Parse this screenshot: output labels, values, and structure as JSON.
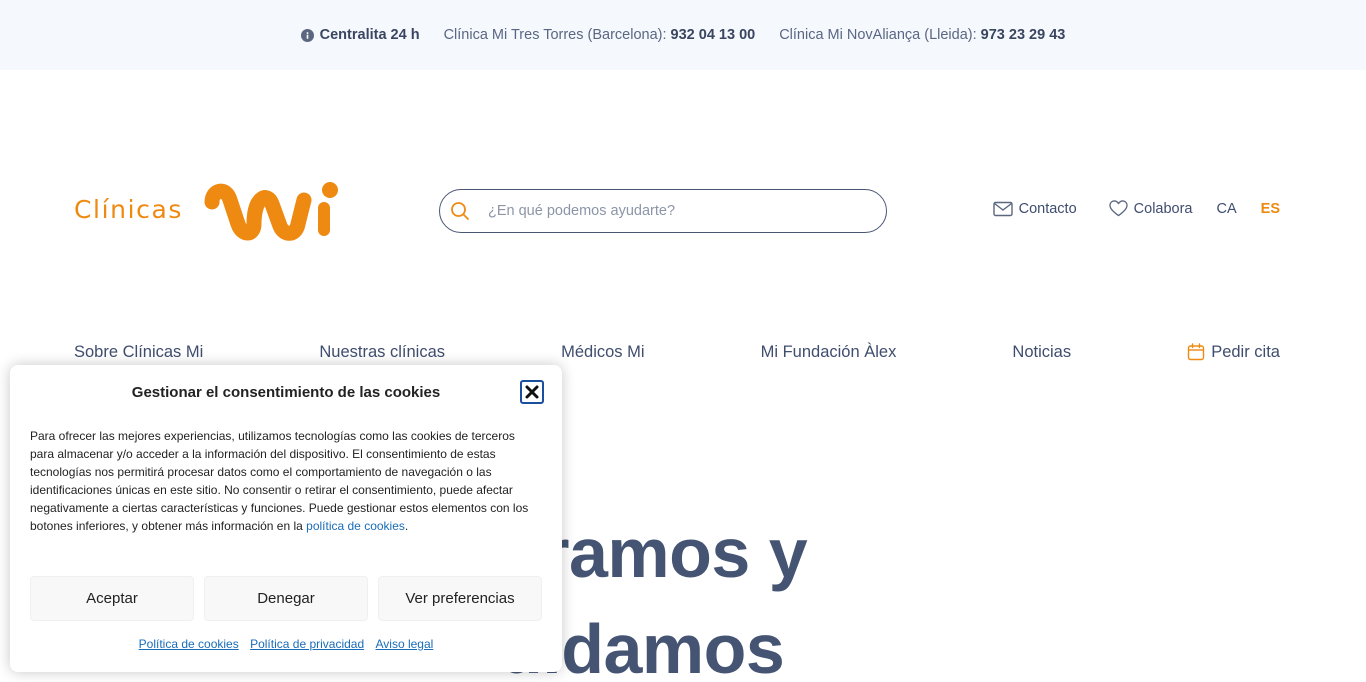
{
  "topbar": {
    "centralita": "Centralita 24 h",
    "clinic1_label": "Clínica Mi Tres Torres (Barcelona):",
    "clinic1_phone": "932 04 13 00",
    "clinic2_label": "Clínica Mi NovAliança (Lleida):",
    "clinic2_phone": "973 23 29 43"
  },
  "header": {
    "logo_text": "Clínicas",
    "search_placeholder": "¿En qué podemos ayudarte?",
    "contact": "Contacto",
    "colabora": "Colabora",
    "lang_ca": "CA",
    "lang_es": "ES"
  },
  "nav": {
    "items": [
      "Sobre Clínicas Mi",
      "Nuestras clínicas",
      "Médicos Mi",
      "Mi Fundación Àlex",
      "Noticias"
    ],
    "cta": "Pedir cita"
  },
  "hero": {
    "line1": "uramos y",
    "line2": "uidamos"
  },
  "cookie": {
    "title": "Gestionar el consentimiento de las cookies",
    "body": "Para ofrecer las mejores experiencias, utilizamos tecnologías como las cookies de terceros para almacenar y/o acceder a la información del dispositivo. El consentimiento de estas tecnologías nos permitirá procesar datos como el comportamiento de navegación o las identificaciones únicas en este sitio. No consentir o retirar el consentimiento, puede afectar negativamente a ciertas características y funciones. Puede gestionar estos elementos con los botones inferiores, y obtener más información en la",
    "body_link": "política de cookies",
    "body_end": ".",
    "accept": "Aceptar",
    "deny": "Denegar",
    "preferences": "Ver preferencias",
    "link_cookies": "Política de cookies",
    "link_privacy": "Política de privacidad",
    "link_legal": "Aviso legal"
  },
  "colors": {
    "brand_orange": "#ee8a12",
    "text_navy": "#3f4d6e",
    "topbar_bg": "#f5f8fd",
    "link_blue": "#1a6cb8"
  },
  "icons": [
    "info-icon",
    "search-icon",
    "mail-icon",
    "heart-icon",
    "calendar-icon",
    "close-icon"
  ]
}
